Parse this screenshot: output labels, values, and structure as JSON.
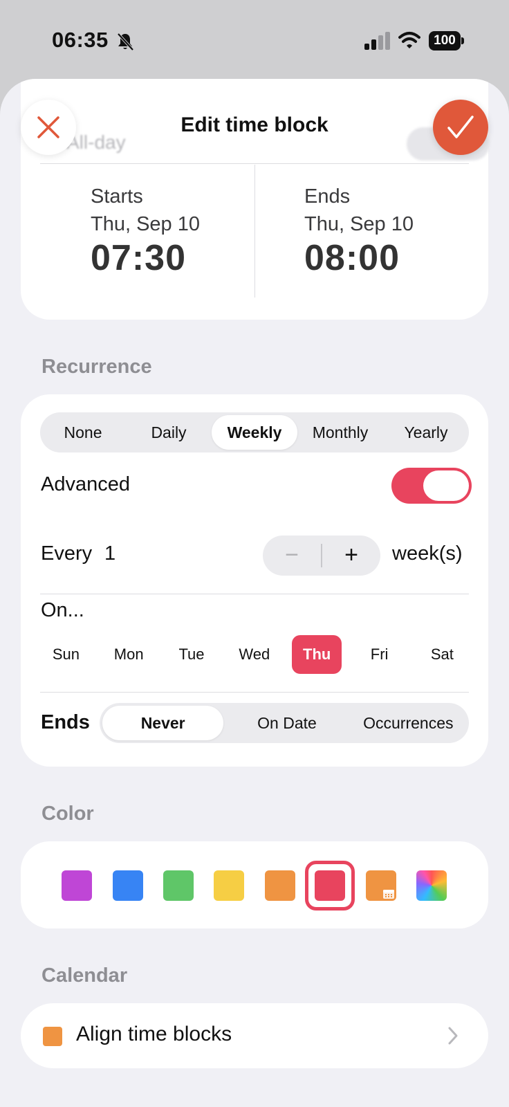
{
  "status_bar": {
    "time": "06:35",
    "battery": "100"
  },
  "header": {
    "title": "Edit time block"
  },
  "all_day": {
    "label": "All-day",
    "enabled": false
  },
  "starts": {
    "label": "Starts",
    "date": "Thu, Sep 10",
    "time": "07:30"
  },
  "ends": {
    "label": "Ends",
    "date": "Thu, Sep 10",
    "time": "08:00"
  },
  "recurrence": {
    "section_label": "Recurrence",
    "options": [
      "None",
      "Daily",
      "Weekly",
      "Monthly",
      "Yearly"
    ],
    "selected": "Weekly",
    "advanced_label": "Advanced",
    "advanced_enabled": true,
    "every_label": "Every",
    "every_value": "1",
    "minus": "−",
    "plus": "+",
    "unit": "week(s)",
    "on_label": "On...",
    "days": [
      "Sun",
      "Mon",
      "Tue",
      "Wed",
      "Thu",
      "Fri",
      "Sat"
    ],
    "selected_day": "Thu",
    "ends_label": "Ends",
    "ends_options": [
      "Never",
      "On Date",
      "Occurrences"
    ],
    "ends_selected": "Never"
  },
  "color": {
    "section_label": "Color",
    "swatches": [
      "#bf46d6",
      "#3784f4",
      "#5fc668",
      "#f6ce44",
      "#ef9442",
      "#e8445e",
      "#ef9442",
      "rainbow"
    ],
    "selected_index": 5
  },
  "calendar": {
    "section_label": "Calendar",
    "name": "Align time blocks",
    "color": "#ef9442"
  },
  "colors": {
    "accent": "#e8445e",
    "confirm": "#e0583a"
  }
}
